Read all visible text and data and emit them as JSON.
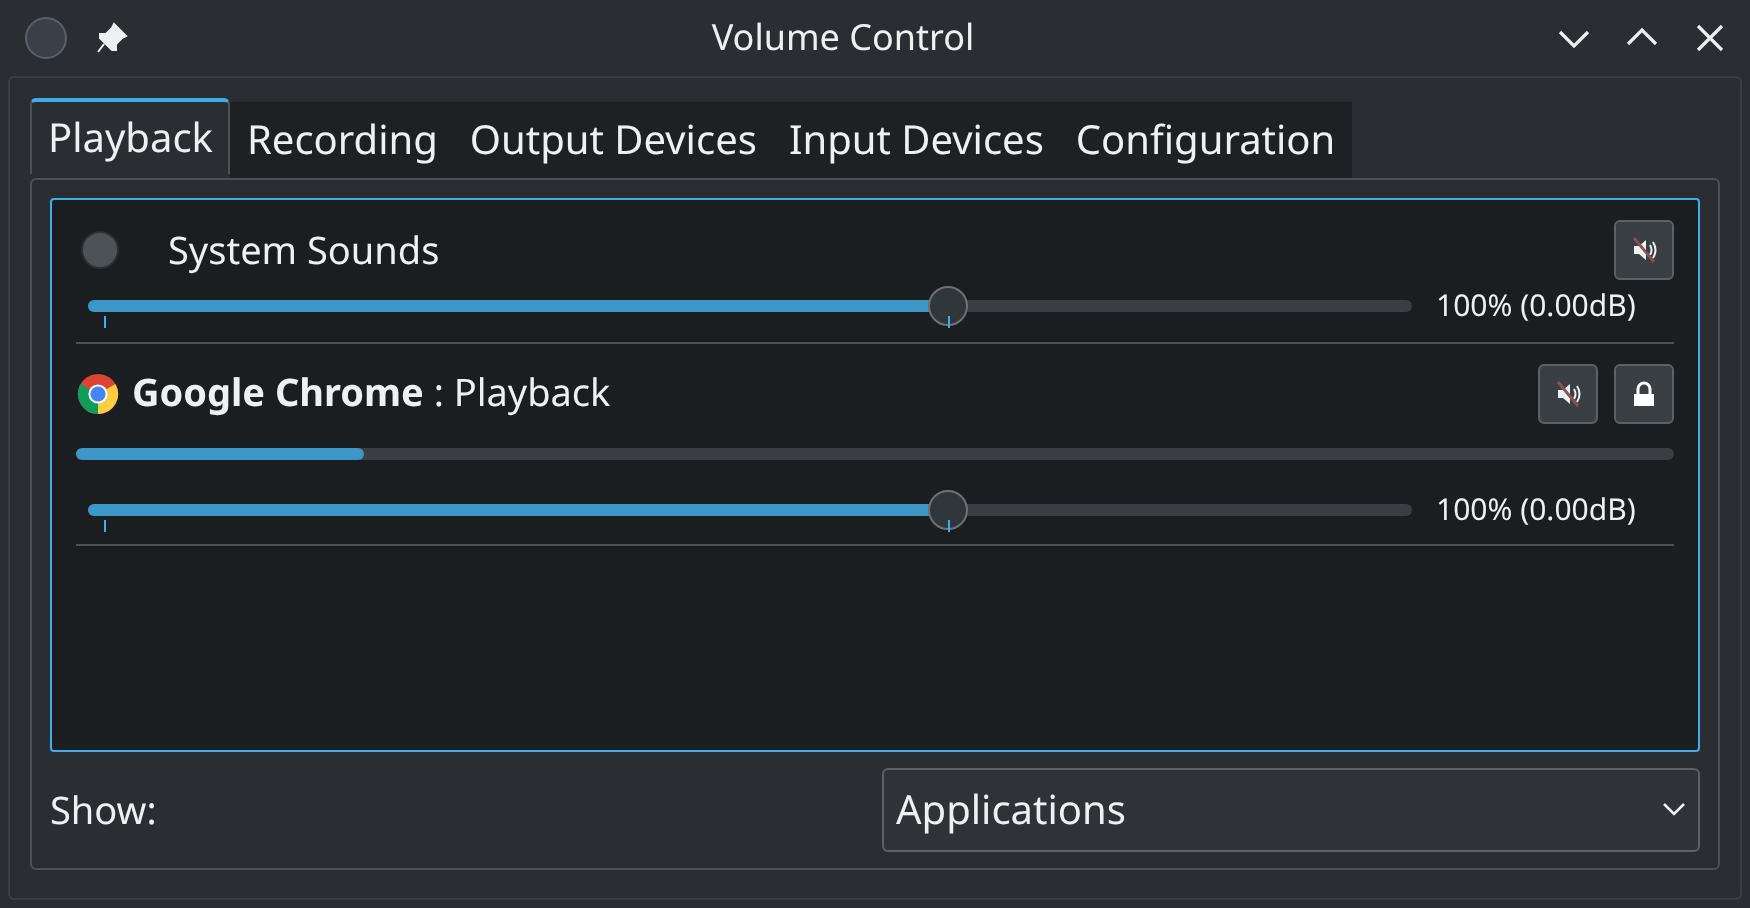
{
  "window": {
    "title": "Volume Control"
  },
  "tabs": [
    {
      "label": "Playback",
      "selected": true
    },
    {
      "label": "Recording",
      "selected": false
    },
    {
      "label": "Output Devices",
      "selected": false
    },
    {
      "label": "Input Devices",
      "selected": false
    },
    {
      "label": "Configuration",
      "selected": false
    }
  ],
  "streams": [
    {
      "kind": "system",
      "name": "System Sounds",
      "muted": false,
      "level": 0.65,
      "reading": "100% (0.00dB)"
    },
    {
      "kind": "app",
      "name": "**Google Chrome** : Playback",
      "muted": false,
      "peak": {
        "level": 0.18
      },
      "level": 0.65,
      "reading": "100% (0.00dB)"
    }
  ],
  "show": {
    "label": "Show:",
    "value": "Applications"
  }
}
